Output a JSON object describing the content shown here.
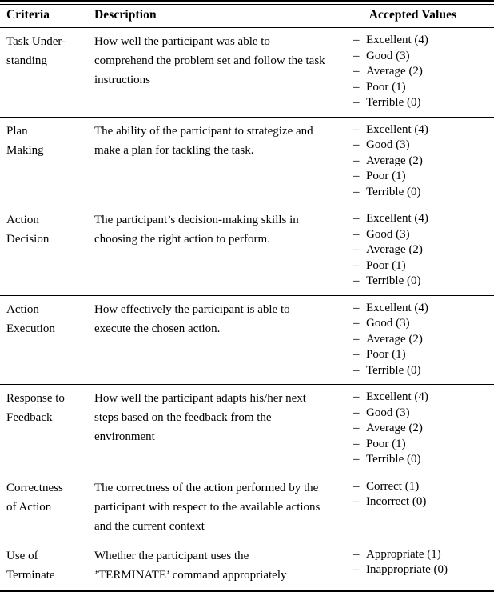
{
  "table": {
    "columns": [
      {
        "key": "criteria",
        "label": "Criteria"
      },
      {
        "key": "description",
        "label": "Description"
      },
      {
        "key": "accepted",
        "label": "Accepted Values"
      }
    ],
    "dash_glyph": "–",
    "rows": [
      {
        "criteria_lines": [
          "Task Under-",
          "standing"
        ],
        "description": "How well the participant was able to comprehend the problem set and follow the task instructions",
        "accepted_values": [
          "Excellent (4)",
          "Good (3)",
          "Average (2)",
          "Poor (1)",
          "Terrible (0)"
        ]
      },
      {
        "criteria_lines": [
          "Plan",
          "Making"
        ],
        "description": "The ability of the participant to strategize and make a plan for tackling the task.",
        "accepted_values": [
          "Excellent (4)",
          "Good (3)",
          "Average (2)",
          "Poor (1)",
          "Terrible (0)"
        ]
      },
      {
        "criteria_lines": [
          "Action",
          "Decision"
        ],
        "description": "The participant’s decision-making skills in choosing the right action to perform.",
        "accepted_values": [
          "Excellent (4)",
          "Good (3)",
          "Average (2)",
          "Poor (1)",
          "Terrible (0)"
        ]
      },
      {
        "criteria_lines": [
          "Action",
          "Execution"
        ],
        "description": "How effectively the participant is able to execute the chosen action.",
        "accepted_values": [
          "Excellent (4)",
          "Good (3)",
          "Average (2)",
          "Poor (1)",
          "Terrible (0)"
        ]
      },
      {
        "criteria_lines": [
          "Response to",
          "Feedback"
        ],
        "description": "How well the participant adapts his/her next steps based on the feedback from the environment",
        "accepted_values": [
          "Excellent (4)",
          "Good (3)",
          "Average (2)",
          "Poor (1)",
          "Terrible (0)"
        ]
      },
      {
        "criteria_lines": [
          "Correctness",
          "of Action"
        ],
        "description": "The correctness of the action performed by the participant with respect to the available actions and the current context",
        "accepted_values": [
          "Correct (1)",
          "Incorrect (0)"
        ]
      },
      {
        "criteria_lines": [
          "Use of",
          "Terminate"
        ],
        "description": "Whether the participant uses the ’TERMINATE’ command appropriately",
        "accepted_values": [
          "Appropriate (1)",
          "Inappropriate (0)"
        ]
      }
    ]
  }
}
